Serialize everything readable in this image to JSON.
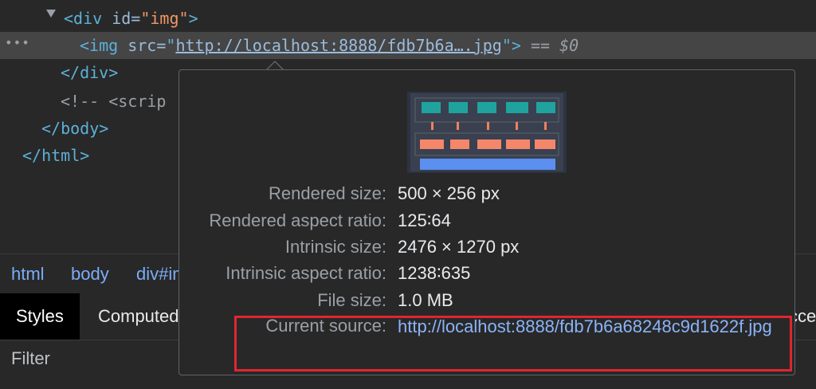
{
  "dom": {
    "div_open_tag": "<div",
    "div_attr_name": "id=",
    "div_attr_value": "\"img\"",
    "div_close_bracket": ">",
    "img_tag_open": "<img",
    "img_attr_name": "src=",
    "img_quote_open": "\"",
    "img_src": "http://localhost:8888/fdb7b6a….jpg",
    "img_quote_close": "\"",
    "img_close_bracket": ">",
    "selected_marker": "== $0",
    "div_close_tag": "</div>",
    "comment_start": "<!-- <scrip",
    "body_close": "</body>",
    "html_close": "</html>",
    "row_dots": "•••"
  },
  "breadcrumb": [
    "html",
    "body",
    "div#im"
  ],
  "tabs": {
    "styles": "Styles",
    "computed": "Computed",
    "right_cut": "cce"
  },
  "filter": {
    "placeholder": "Filter"
  },
  "tooltip": {
    "rows": [
      {
        "label": "Rendered size:",
        "value": "500 × 256 px"
      },
      {
        "label": "Rendered aspect ratio:",
        "value": "125∶64"
      },
      {
        "label": "Intrinsic size:",
        "value": "2476 × 1270 px"
      },
      {
        "label": "Intrinsic aspect ratio:",
        "value": "1238∶635"
      },
      {
        "label": "File size:",
        "value": "1.0 MB"
      }
    ],
    "current_source_label": "Current source:",
    "current_source_url": "http://localhost:8888/fdb7b6a68248c9d1622f.jpg"
  },
  "colors": {
    "highlight_box": "#e0262f",
    "link": "#8ab4f8",
    "tag": "#5db0d7",
    "attr_value": "#f29766"
  }
}
